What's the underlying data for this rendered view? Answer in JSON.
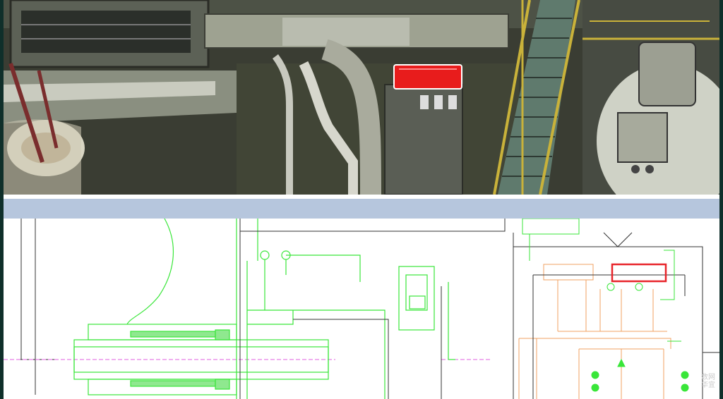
{
  "photo": {
    "highlight_color": "#e81c1c",
    "stair_color": "#c9b23a"
  },
  "drawing": {
    "highlight_color": "#e8242a",
    "green_line_color": "#39e639",
    "orange_line_color": "#f0a060",
    "pink_centerline_color": "#e060e0"
  },
  "watermark": {
    "line1": "数网",
    "line2": "华宜"
  }
}
